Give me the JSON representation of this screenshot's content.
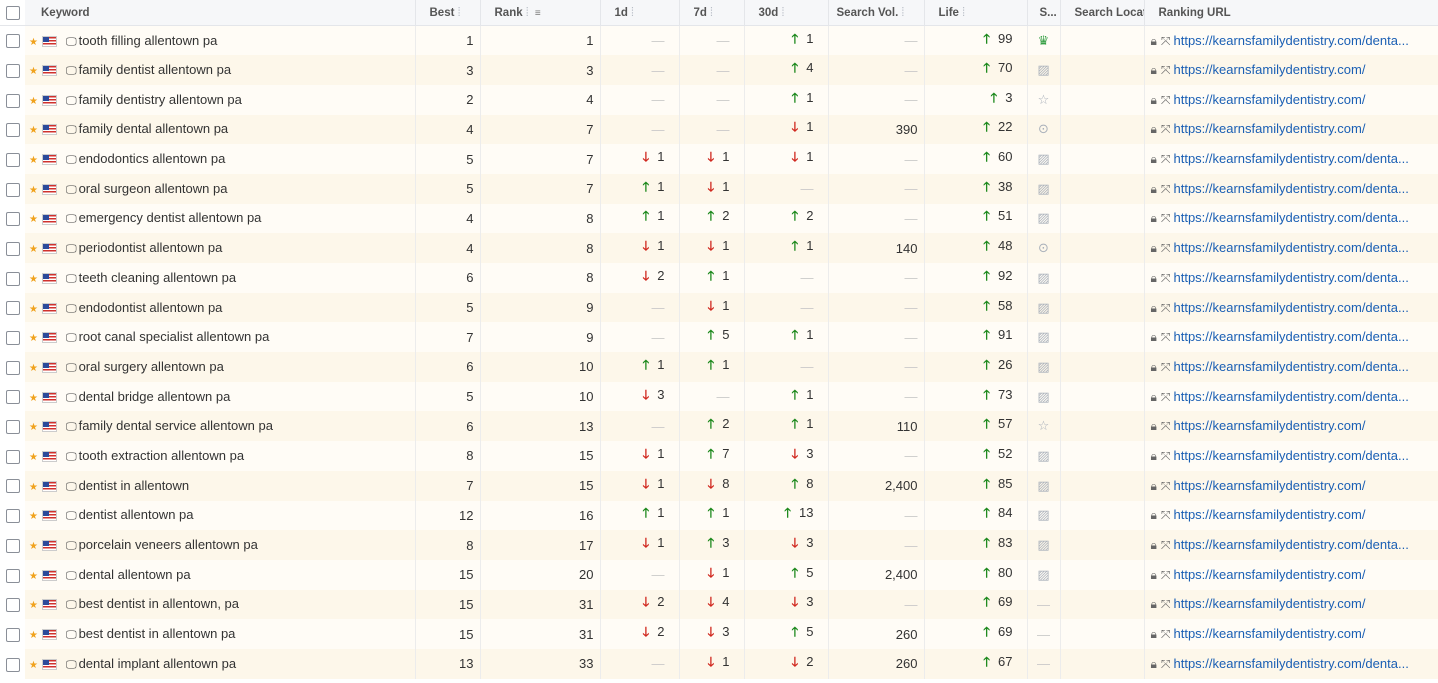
{
  "headers": {
    "keyword": "Keyword",
    "best": "Best",
    "rank": "Rank",
    "d1": "1d",
    "d7": "7d",
    "d30": "30d",
    "search_vol": "Search Vol.",
    "life": "Life",
    "serp": "S...",
    "search_location": "Search Locati",
    "ranking_url": "Ranking URL"
  },
  "colors": {
    "up": "#1f8a1f",
    "down": "#d0281f",
    "link": "#1a5fb4",
    "row_alt": "#fdf7ea"
  },
  "icons": {
    "star": "star-icon",
    "flag": "us-flag-icon",
    "monitor": "desktop-icon",
    "lock": "lock-icon",
    "expand": "expand-icon"
  },
  "rows": [
    {
      "keyword": "tooth filling allentown pa",
      "best": "1",
      "rank": "1",
      "d1": null,
      "d7": null,
      "d30": {
        "dir": "up",
        "v": "1"
      },
      "vol": null,
      "life": {
        "dir": "up",
        "v": "99"
      },
      "serp": "crown",
      "url": "https://kearnsfamilydentistry.com/denta..."
    },
    {
      "keyword": "family dentist allentown pa",
      "best": "3",
      "rank": "3",
      "d1": null,
      "d7": null,
      "d30": {
        "dir": "up",
        "v": "4"
      },
      "vol": null,
      "life": {
        "dir": "up",
        "v": "70"
      },
      "serp": "image",
      "url": "https://kearnsfamilydentistry.com/"
    },
    {
      "keyword": "family dentistry allentown pa",
      "best": "2",
      "rank": "4",
      "d1": null,
      "d7": null,
      "d30": {
        "dir": "up",
        "v": "1"
      },
      "vol": null,
      "life": {
        "dir": "up",
        "v": "3"
      },
      "serp": "star",
      "url": "https://kearnsfamilydentistry.com/"
    },
    {
      "keyword": "family dental allentown pa",
      "best": "4",
      "rank": "7",
      "d1": null,
      "d7": null,
      "d30": {
        "dir": "down",
        "v": "1"
      },
      "vol": "390",
      "life": {
        "dir": "up",
        "v": "22"
      },
      "serp": "pin",
      "url": "https://kearnsfamilydentistry.com/"
    },
    {
      "keyword": "endodontics allentown pa",
      "best": "5",
      "rank": "7",
      "d1": {
        "dir": "down",
        "v": "1"
      },
      "d7": {
        "dir": "down",
        "v": "1"
      },
      "d30": {
        "dir": "down",
        "v": "1"
      },
      "vol": null,
      "life": {
        "dir": "up",
        "v": "60"
      },
      "serp": "image",
      "url": "https://kearnsfamilydentistry.com/denta..."
    },
    {
      "keyword": "oral surgeon allentown pa",
      "best": "5",
      "rank": "7",
      "d1": {
        "dir": "up",
        "v": "1"
      },
      "d7": {
        "dir": "down",
        "v": "1"
      },
      "d30": null,
      "vol": null,
      "life": {
        "dir": "up",
        "v": "38"
      },
      "serp": "image",
      "url": "https://kearnsfamilydentistry.com/denta..."
    },
    {
      "keyword": "emergency dentist allentown pa",
      "best": "4",
      "rank": "8",
      "d1": {
        "dir": "up",
        "v": "1"
      },
      "d7": {
        "dir": "up",
        "v": "2"
      },
      "d30": {
        "dir": "up",
        "v": "2"
      },
      "vol": null,
      "life": {
        "dir": "up",
        "v": "51"
      },
      "serp": "image",
      "url": "https://kearnsfamilydentistry.com/denta..."
    },
    {
      "keyword": "periodontist allentown pa",
      "best": "4",
      "rank": "8",
      "d1": {
        "dir": "down",
        "v": "1"
      },
      "d7": {
        "dir": "down",
        "v": "1"
      },
      "d30": {
        "dir": "up",
        "v": "1"
      },
      "vol": "140",
      "life": {
        "dir": "up",
        "v": "48"
      },
      "serp": "pin",
      "url": "https://kearnsfamilydentistry.com/denta..."
    },
    {
      "keyword": "teeth cleaning allentown pa",
      "best": "6",
      "rank": "8",
      "d1": {
        "dir": "down",
        "v": "2"
      },
      "d7": {
        "dir": "up",
        "v": "1"
      },
      "d30": null,
      "vol": null,
      "life": {
        "dir": "up",
        "v": "92"
      },
      "serp": "image",
      "url": "https://kearnsfamilydentistry.com/denta..."
    },
    {
      "keyword": "endodontist allentown pa",
      "best": "5",
      "rank": "9",
      "d1": null,
      "d7": {
        "dir": "down",
        "v": "1"
      },
      "d30": null,
      "vol": null,
      "life": {
        "dir": "up",
        "v": "58"
      },
      "serp": "image",
      "url": "https://kearnsfamilydentistry.com/denta..."
    },
    {
      "keyword": "root canal specialist allentown pa",
      "best": "7",
      "rank": "9",
      "d1": null,
      "d7": {
        "dir": "up",
        "v": "5"
      },
      "d30": {
        "dir": "up",
        "v": "1"
      },
      "vol": null,
      "life": {
        "dir": "up",
        "v": "91"
      },
      "serp": "image",
      "url": "https://kearnsfamilydentistry.com/denta..."
    },
    {
      "keyword": "oral surgery allentown pa",
      "best": "6",
      "rank": "10",
      "d1": {
        "dir": "up",
        "v": "1"
      },
      "d7": {
        "dir": "up",
        "v": "1"
      },
      "d30": null,
      "vol": null,
      "life": {
        "dir": "up",
        "v": "26"
      },
      "serp": "image",
      "url": "https://kearnsfamilydentistry.com/denta..."
    },
    {
      "keyword": "dental bridge allentown pa",
      "best": "5",
      "rank": "10",
      "d1": {
        "dir": "down",
        "v": "3"
      },
      "d7": null,
      "d30": {
        "dir": "up",
        "v": "1"
      },
      "vol": null,
      "life": {
        "dir": "up",
        "v": "73"
      },
      "serp": "image",
      "url": "https://kearnsfamilydentistry.com/denta..."
    },
    {
      "keyword": "family dental service allentown pa",
      "best": "6",
      "rank": "13",
      "d1": null,
      "d7": {
        "dir": "up",
        "v": "2"
      },
      "d30": {
        "dir": "up",
        "v": "1"
      },
      "vol": "110",
      "life": {
        "dir": "up",
        "v": "57"
      },
      "serp": "star",
      "url": "https://kearnsfamilydentistry.com/"
    },
    {
      "keyword": "tooth extraction allentown pa",
      "best": "8",
      "rank": "15",
      "d1": {
        "dir": "down",
        "v": "1"
      },
      "d7": {
        "dir": "up",
        "v": "7"
      },
      "d30": {
        "dir": "down",
        "v": "3"
      },
      "vol": null,
      "life": {
        "dir": "up",
        "v": "52"
      },
      "serp": "image",
      "url": "https://kearnsfamilydentistry.com/denta..."
    },
    {
      "keyword": "dentist in allentown",
      "best": "7",
      "rank": "15",
      "d1": {
        "dir": "down",
        "v": "1"
      },
      "d7": {
        "dir": "down",
        "v": "8"
      },
      "d30": {
        "dir": "up",
        "v": "8"
      },
      "vol": "2,400",
      "life": {
        "dir": "up",
        "v": "85"
      },
      "serp": "image",
      "url": "https://kearnsfamilydentistry.com/"
    },
    {
      "keyword": "dentist allentown pa",
      "best": "12",
      "rank": "16",
      "d1": {
        "dir": "up",
        "v": "1"
      },
      "d7": {
        "dir": "up",
        "v": "1"
      },
      "d30": {
        "dir": "up",
        "v": "13"
      },
      "vol": null,
      "life": {
        "dir": "up",
        "v": "84"
      },
      "serp": "image",
      "url": "https://kearnsfamilydentistry.com/"
    },
    {
      "keyword": "porcelain veneers allentown pa",
      "best": "8",
      "rank": "17",
      "d1": {
        "dir": "down",
        "v": "1"
      },
      "d7": {
        "dir": "up",
        "v": "3"
      },
      "d30": {
        "dir": "down",
        "v": "3"
      },
      "vol": null,
      "life": {
        "dir": "up",
        "v": "83"
      },
      "serp": "image",
      "url": "https://kearnsfamilydentistry.com/denta..."
    },
    {
      "keyword": "dental allentown pa",
      "best": "15",
      "rank": "20",
      "d1": null,
      "d7": {
        "dir": "down",
        "v": "1"
      },
      "d30": {
        "dir": "up",
        "v": "5"
      },
      "vol": "2,400",
      "life": {
        "dir": "up",
        "v": "80"
      },
      "serp": "image",
      "url": "https://kearnsfamilydentistry.com/"
    },
    {
      "keyword": "best dentist in allentown, pa",
      "best": "15",
      "rank": "31",
      "d1": {
        "dir": "down",
        "v": "2"
      },
      "d7": {
        "dir": "down",
        "v": "4"
      },
      "d30": {
        "dir": "down",
        "v": "3"
      },
      "vol": null,
      "life": {
        "dir": "up",
        "v": "69"
      },
      "serp": null,
      "url": "https://kearnsfamilydentistry.com/"
    },
    {
      "keyword": "best dentist in allentown pa",
      "best": "15",
      "rank": "31",
      "d1": {
        "dir": "down",
        "v": "2"
      },
      "d7": {
        "dir": "down",
        "v": "3"
      },
      "d30": {
        "dir": "up",
        "v": "5"
      },
      "vol": "260",
      "life": {
        "dir": "up",
        "v": "69"
      },
      "serp": null,
      "url": "https://kearnsfamilydentistry.com/"
    },
    {
      "keyword": "dental implant allentown pa",
      "best": "13",
      "rank": "33",
      "d1": null,
      "d7": {
        "dir": "down",
        "v": "1"
      },
      "d30": {
        "dir": "down",
        "v": "2"
      },
      "vol": "260",
      "life": {
        "dir": "up",
        "v": "67"
      },
      "serp": null,
      "url": "https://kearnsfamilydentistry.com/denta..."
    }
  ]
}
